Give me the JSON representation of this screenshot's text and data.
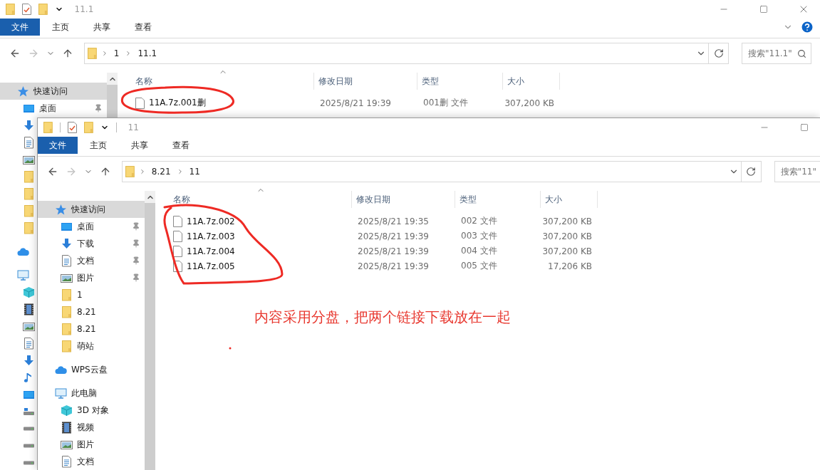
{
  "back_window": {
    "title": "11.1",
    "controls": [
      {
        "kind": "minimize"
      },
      {
        "kind": "maximize"
      },
      {
        "kind": "close"
      }
    ],
    "help": true,
    "ribbon_tabs": [
      {
        "kind": "file",
        "label": "文件"
      },
      {
        "kind": "tab",
        "label": "主页"
      },
      {
        "kind": "tab",
        "label": "共享"
      },
      {
        "kind": "tab",
        "label": "查看"
      }
    ],
    "path": [
      "1",
      "11.1"
    ],
    "search": {
      "placeholder": "搜索\"11.1\"",
      "icon": true
    },
    "sidebar": [
      {
        "kind": "quick",
        "label": "快速访问",
        "selected": true,
        "children": [
          {
            "kind": "desktop",
            "label": "桌面",
            "pinned": true,
            "selected": false
          },
          {
            "kind": "download",
            "selected": false
          },
          {
            "kind": "docs",
            "selected": false
          },
          {
            "kind": "pictures",
            "selected": false
          },
          {
            "kind": "folder",
            "selected": false
          },
          {
            "kind": "folder",
            "selected": false
          },
          {
            "kind": "folder",
            "selected": false
          },
          {
            "kind": "folder",
            "selected": false
          }
        ]
      },
      {
        "kind": "cloud",
        "selected": false
      },
      {
        "kind": "pc",
        "selected": false,
        "children": [
          {
            "kind": "cube",
            "selected": false
          },
          {
            "kind": "video",
            "selected": false
          },
          {
            "kind": "pictures",
            "selected": false
          },
          {
            "kind": "docs",
            "selected": false
          },
          {
            "kind": "download",
            "selected": false
          },
          {
            "kind": "music",
            "selected": false
          },
          {
            "kind": "desktop",
            "selected": false
          },
          {
            "kind": "netdrive",
            "selected": false
          },
          {
            "kind": "drive",
            "selected": false
          },
          {
            "kind": "drive",
            "selected": false
          },
          {
            "kind": "drive",
            "selected": false
          }
        ]
      }
    ],
    "columns": [
      "名称",
      "修改日期",
      "类型",
      "大小"
    ],
    "files": [
      {
        "name": "11A.7z.001删",
        "date": "2025/8/21 19:39",
        "type": "001删 文件",
        "size": "307,200 KB",
        "selected": false
      }
    ]
  },
  "front_window": {
    "title": "11",
    "controls": [
      {
        "kind": "minimize"
      },
      {
        "kind": "maximize"
      }
    ],
    "ribbon_tabs": [
      {
        "kind": "file",
        "label": "文件"
      },
      {
        "kind": "tab",
        "label": "主页"
      },
      {
        "kind": "tab",
        "label": "共享"
      },
      {
        "kind": "tab",
        "label": "查看"
      }
    ],
    "path": [
      "8.21",
      "11"
    ],
    "search": {
      "placeholder": "搜索\"11\""
    },
    "sidebar": [
      {
        "kind": "quick",
        "label": "快速访问",
        "selected": true,
        "children": [
          {
            "kind": "desktop",
            "label": "桌面",
            "pinned": true,
            "selected": false
          },
          {
            "kind": "download",
            "label": "下载",
            "pinned": true,
            "selected": false
          },
          {
            "kind": "docs",
            "label": "文档",
            "pinned": true,
            "selected": false
          },
          {
            "kind": "pictures",
            "label": "图片",
            "pinned": true,
            "selected": false
          },
          {
            "kind": "folder",
            "label": "1",
            "selected": false
          },
          {
            "kind": "folder",
            "label": "8.21",
            "selected": false
          },
          {
            "kind": "folder",
            "label": "8.21",
            "selected": false
          },
          {
            "kind": "folder",
            "label": "萌站",
            "selected": false
          }
        ]
      },
      {
        "kind": "cloud",
        "label": "WPS云盘",
        "selected": false
      },
      {
        "kind": "pc",
        "label": "此电脑",
        "selected": false,
        "children": [
          {
            "kind": "cube",
            "label": "3D 对象",
            "selected": false
          },
          {
            "kind": "video",
            "label": "视频",
            "selected": false
          },
          {
            "kind": "pictures",
            "label": "图片",
            "selected": false
          },
          {
            "kind": "docs",
            "label": "文档",
            "selected": false
          }
        ]
      }
    ],
    "columns": [
      "名称",
      "修改日期",
      "类型",
      "大小"
    ],
    "files": [
      {
        "name": "11A.7z.002",
        "date": "2025/8/21 19:35",
        "type": "002 文件",
        "size": "307,200 KB",
        "selected": false
      },
      {
        "name": "11A.7z.003",
        "date": "2025/8/21 19:39",
        "type": "003 文件",
        "size": "307,200 KB",
        "selected": false
      },
      {
        "name": "11A.7z.004",
        "date": "2025/8/21 19:39",
        "type": "004 文件",
        "size": "307,200 KB",
        "selected": false
      },
      {
        "name": "11A.7z.005",
        "date": "2025/8/21 19:39",
        "type": "005 文件",
        "size": "17,206 KB",
        "selected": false
      }
    ]
  },
  "annotation": {
    "note": "内容采用分盘，把两个链接下载放在一起"
  }
}
